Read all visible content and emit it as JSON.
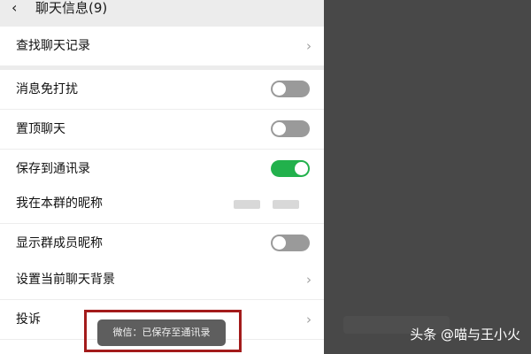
{
  "header": {
    "back_icon": "back-chevron-icon",
    "title": "聊天信息(9)"
  },
  "groups": [
    {
      "rows": [
        {
          "label": "查找聊天记录",
          "control": "chevron"
        }
      ]
    },
    {
      "rows": [
        {
          "label": "消息免打扰",
          "control": "toggle",
          "on": false
        },
        {
          "label": "置顶聊天",
          "control": "toggle",
          "on": false
        },
        {
          "label": "保存到通讯录",
          "control": "toggle",
          "on": true
        }
      ]
    },
    {
      "rows": [
        {
          "label": "我在本群的昵称",
          "control": "nickname"
        },
        {
          "label": "显示群成员昵称",
          "control": "toggle",
          "on": false
        }
      ]
    },
    {
      "rows": [
        {
          "label": "设置当前聊天背景",
          "control": "chevron"
        },
        {
          "label": "投诉",
          "control": "chevron"
        }
      ]
    }
  ],
  "toast": {
    "text": "微信：已保存至通讯录"
  },
  "watermark": {
    "text": "头条 @喵与王小火"
  },
  "colors": {
    "toggle_on": "#22b14c",
    "toggle_off": "#9a9a9a",
    "highlight_box": "#a31b1b"
  }
}
